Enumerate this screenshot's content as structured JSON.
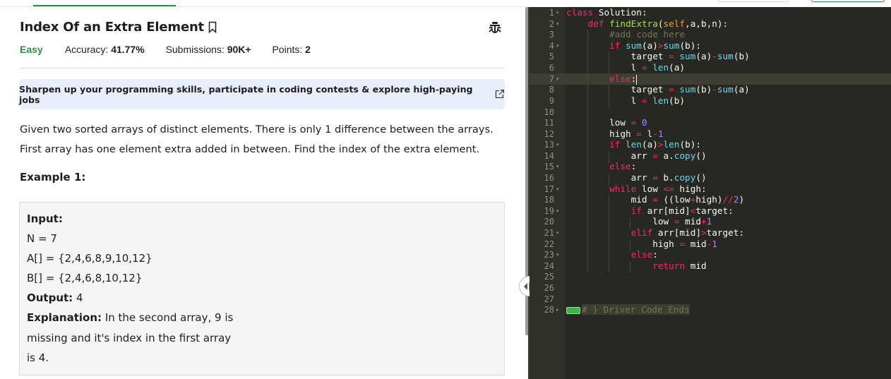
{
  "problem": {
    "title": "Index Of an Extra Element",
    "difficulty": "Easy",
    "accuracy_label": "Accuracy: ",
    "accuracy_value": "41.77%",
    "submissions_label": "Submissions: ",
    "submissions_value": "90K+",
    "points_label": "Points: ",
    "points_value": "2",
    "banner": "Sharpen up your programming skills, participate in coding contests & explore high-paying jobs",
    "statement_1": "Given two sorted arrays of distinct elements. There is only 1 difference between the arrays.",
    "statement_2": "First array has one element extra added in between. Find the index of the extra element.",
    "example_title": "Example 1:",
    "example": {
      "input_label": "Input:",
      "n": "N = 7",
      "a": "A[] = {2,4,6,8,9,10,12}",
      "b": "B[] = {2,4,6,8,10,12}",
      "output_label": "Output:",
      "output_value": "4",
      "explanation_label": "Explanation:",
      "explanation_1": "In the second array, 9 is",
      "explanation_2": "missing and it's index in the first array",
      "explanation_3": "is 4."
    }
  },
  "editor": {
    "line_numbers": [
      "1",
      "2",
      "3",
      "4",
      "5",
      "6",
      "7",
      "8",
      "9",
      "10",
      "11",
      "12",
      "13",
      "14",
      "15",
      "16",
      "17",
      "18",
      "19",
      "20",
      "21",
      "22",
      "23",
      "24",
      "25",
      "26",
      "27",
      "28"
    ],
    "collapsed_text": "# } Driver Code Ends"
  },
  "colors": {
    "accent_green": "#2f8d46",
    "banner_bg": "#e8eefa",
    "editor_bg": "#272822"
  }
}
